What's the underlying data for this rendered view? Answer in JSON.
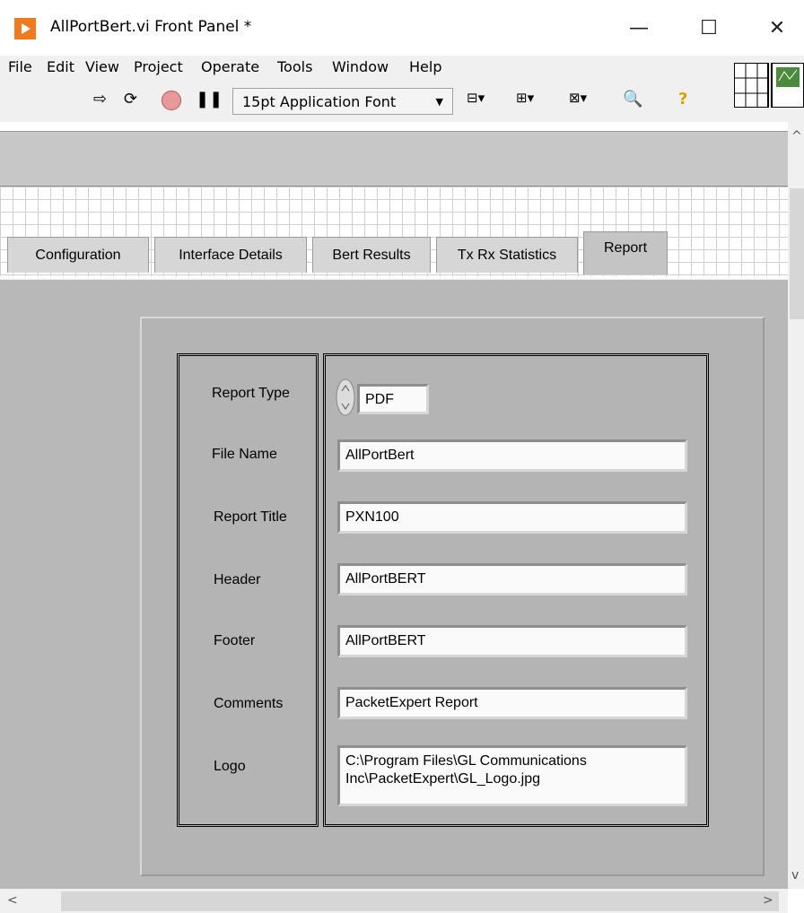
{
  "window": {
    "title": "AllPortBert.vi Front Panel *",
    "minimize_glyph": "—",
    "maximize_glyph": "☐",
    "close_glyph": "✕"
  },
  "menu": [
    "File",
    "Edit",
    "View",
    "Project",
    "Operate",
    "Tools",
    "Window",
    "Help"
  ],
  "toolbar": {
    "font_select": "15pt Application Font"
  },
  "tabs": [
    {
      "label": "Configuration"
    },
    {
      "label": "Interface Details"
    },
    {
      "label": "Bert Results"
    },
    {
      "label": "Tx Rx Statistics"
    },
    {
      "label": "Report",
      "selected": true
    }
  ],
  "report": {
    "labels": {
      "report_type": "Report Type",
      "file_name": "File Name",
      "report_title": "Report Title",
      "header": "Header",
      "footer": "Footer",
      "comments": "Comments",
      "logo": "Logo"
    },
    "values": {
      "report_type": "PDF",
      "file_name": "AllPortBert",
      "report_title": "PXN100",
      "header": "AllPortBERT",
      "footer": "AllPortBERT",
      "comments": "PacketExpert Report",
      "logo": "C:\\Program Files\\GL Communications Inc\\PacketExpert\\GL_Logo.jpg"
    }
  },
  "icons": [
    "run-arrow-icon",
    "run-continuous-icon",
    "abort-icon",
    "pause-icon",
    "align-icon",
    "distribute-icon",
    "resize-icon",
    "search-icon",
    "help-icon"
  ]
}
